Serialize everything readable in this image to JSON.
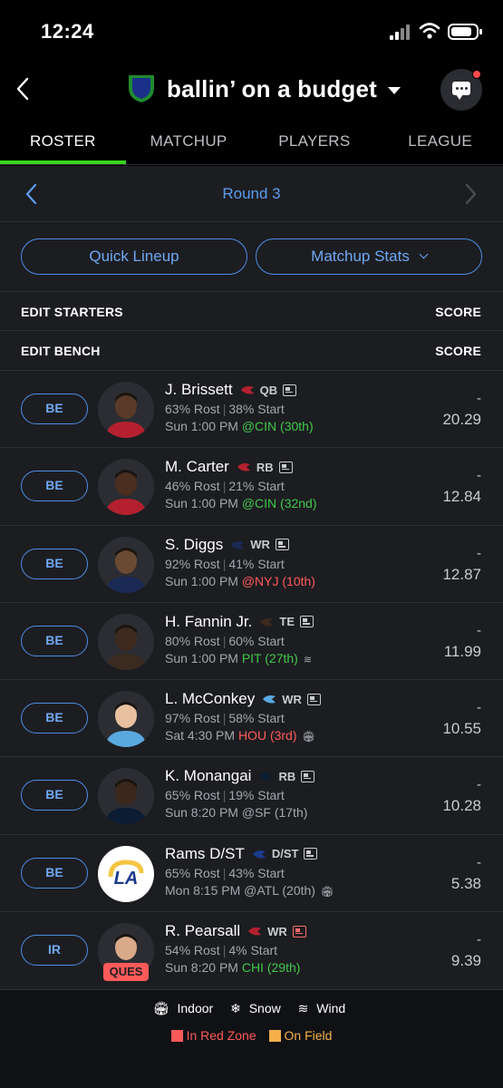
{
  "status_bar": {
    "time": "12:24"
  },
  "header": {
    "league_name": "ballin’ on a budget"
  },
  "tabs": [
    {
      "label": "ROSTER",
      "active": true
    },
    {
      "label": "MATCHUP",
      "active": false
    },
    {
      "label": "PLAYERS",
      "active": false
    },
    {
      "label": "LEAGUE",
      "active": false
    }
  ],
  "round": {
    "label": "Round 3"
  },
  "buttons": {
    "quick_lineup": "Quick Lineup",
    "matchup_stats": "Matchup Stats"
  },
  "sections": {
    "starters": {
      "label": "EDIT STARTERS",
      "score_label": "SCORE"
    },
    "bench": {
      "label": "EDIT BENCH",
      "score_label": "SCORE"
    }
  },
  "players": [
    {
      "slot": "BE",
      "name": "J. Brissett",
      "pos": "QB",
      "rost": "63% Rost",
      "start": "38% Start",
      "time": "Sun 1:00 PM",
      "opp": "@CIN (30th)",
      "opp_tone": "good",
      "weather": "",
      "score_dash": "-",
      "score": "20.29",
      "status": ""
    },
    {
      "slot": "BE",
      "name": "M. Carter",
      "pos": "RB",
      "rost": "46% Rost",
      "start": "21% Start",
      "time": "Sun 1:00 PM",
      "opp": "@CIN (32nd)",
      "opp_tone": "good",
      "weather": "",
      "score_dash": "-",
      "score": "12.84",
      "status": ""
    },
    {
      "slot": "BE",
      "name": "S. Diggs",
      "pos": "WR",
      "rost": "92% Rost",
      "start": "41% Start",
      "time": "Sun 1:00 PM",
      "opp": "@NYJ (10th)",
      "opp_tone": "bad",
      "weather": "",
      "score_dash": "-",
      "score": "12.87",
      "status": ""
    },
    {
      "slot": "BE",
      "name": "H. Fannin Jr.",
      "pos": "TE",
      "rost": "80% Rost",
      "start": "60% Start",
      "time": "Sun 1:00 PM",
      "opp": "PIT (27th)",
      "opp_tone": "good",
      "weather": "wind",
      "score_dash": "-",
      "score": "11.99",
      "status": ""
    },
    {
      "slot": "BE",
      "name": "L. McConkey",
      "pos": "WR",
      "rost": "97% Rost",
      "start": "58% Start",
      "time": "Sat 4:30 PM",
      "opp": "HOU (3rd)",
      "opp_tone": "bad",
      "weather": "indoor",
      "score_dash": "-",
      "score": "10.55",
      "status": ""
    },
    {
      "slot": "BE",
      "name": "K. Monangai",
      "pos": "RB",
      "rost": "65% Rost",
      "start": "19% Start",
      "time": "Sun 8:20 PM",
      "opp": "@SF (17th)",
      "opp_tone": "neutral",
      "weather": "",
      "score_dash": "-",
      "score": "10.28",
      "status": ""
    },
    {
      "slot": "BE",
      "name": "Rams D/ST",
      "pos": "D/ST",
      "rost": "65% Rost",
      "start": "43% Start",
      "time": "Mon 8:15 PM",
      "opp": "@ATL (20th)",
      "opp_tone": "neutral",
      "weather": "indoor",
      "score_dash": "-",
      "score": "5.38",
      "status": ""
    },
    {
      "slot": "IR",
      "name": "R. Pearsall",
      "pos": "WR",
      "rost": "54% Rost",
      "start": "4% Start",
      "time": "Sun 8:20 PM",
      "opp": "CHI (29th)",
      "opp_tone": "good",
      "weather": "",
      "score_dash": "-",
      "score": "9.39",
      "status": "QUES"
    }
  ],
  "legend": {
    "indoor": "Indoor",
    "snow": "Snow",
    "wind": "Wind",
    "red_zone": "In Red Zone",
    "on_field": "On Field",
    "red_zone_color": "#ff5a5a",
    "on_field_color": "#f5b04a"
  },
  "colors": {
    "accent_green": "#39d51f",
    "link_blue": "#5b9cf0",
    "good": "#41c84a",
    "bad": "#ff5a5a"
  }
}
